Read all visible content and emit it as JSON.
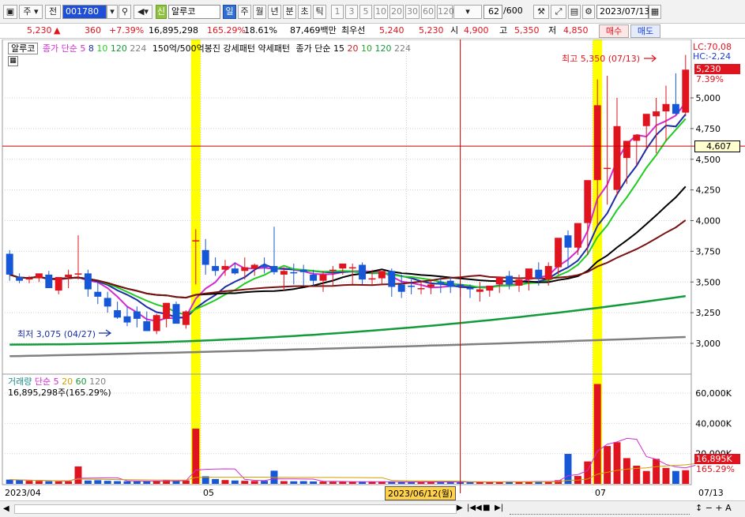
{
  "toolbar": {
    "market_label": "주",
    "prev_label": "전",
    "code": "001780",
    "stock_badge": "신",
    "stock_name": "알루코",
    "periods": [
      "일",
      "주",
      "월",
      "년",
      "분",
      "초",
      "틱"
    ],
    "active_period": "일",
    "intervals": [
      "1",
      "3",
      "5",
      "10",
      "20",
      "30",
      "60",
      "120"
    ],
    "count": "62",
    "count_total": "/600",
    "date": "2023/07/13"
  },
  "quote": {
    "price": "5,230",
    "change_arrow": "▲",
    "change": "360",
    "change_pct": "+7.39%",
    "volume": "16,895,298",
    "volume_ratio": "165.29%",
    "turnover": "18.61%",
    "amount": "87,469백만",
    "best_label": "최우선",
    "best_ask": "5,240",
    "best_bid": "5,230",
    "open_label": "시",
    "open": "4,900",
    "high_label": "고",
    "high": "5,350",
    "low_label": "저",
    "low": "4,850",
    "buy_label": "매수",
    "sell_label": "매도"
  },
  "legend": {
    "name": "알루코",
    "ma_label": "종가 단순",
    "ma_periods": [
      "5",
      "8",
      "10",
      "120",
      "224"
    ],
    "pattern": "150억/500억봉진 강세패턴  약세패턴",
    "ma2_label": "종가 단순 15",
    "ma2_periods": [
      "20",
      "10",
      "120",
      "224"
    ]
  },
  "volume_legend": {
    "label": "거래량",
    "ma_label": "단순 5",
    "ma_periods": [
      "20",
      "60",
      "120"
    ],
    "value": "16,895,298주(165.29%)"
  },
  "annotations": {
    "high_note": "최고 5,350 (07/13)",
    "low_note": "최저 3,075 (04/27)",
    "lc": "LC:70,08",
    "hc": "HC:-2,24",
    "last_price": "5,230",
    "last_pct": "7.39%",
    "cross_price": "4,607",
    "last_volume": "16,895K",
    "last_vol_pct": "165.29%",
    "cross_date": "2023/06/12(월)"
  },
  "axis": {
    "price_ticks": [
      "5,000",
      "4,750",
      "4,500",
      "4,250",
      "4,000",
      "3,750",
      "3,500",
      "3,250",
      "3,000"
    ],
    "volume_ticks": [
      "60,000K",
      "40,000K",
      "20,000K"
    ],
    "date_labels": [
      "2023/04",
      "05",
      "06",
      "07",
      "07/13"
    ]
  },
  "colors": {
    "up": "#e0141e",
    "down": "#1657d8",
    "highlight": "#ffff00",
    "ma5": "#d22bd2",
    "ma8": "#1a2ea8",
    "ma10": "#22cc22",
    "ma20": "#000000",
    "ma60": "#7a1010",
    "ma120": "#139a3a",
    "ma224": "#808080"
  },
  "chart_data": {
    "type": "candlestick",
    "dates": [
      "04/03",
      "04/04",
      "04/05",
      "04/06",
      "04/07",
      "04/10",
      "04/11",
      "04/12",
      "04/13",
      "04/14",
      "04/17",
      "04/18",
      "04/19",
      "04/20",
      "04/21",
      "04/24",
      "04/25",
      "04/26",
      "04/27",
      "04/28",
      "05/02",
      "05/03",
      "05/04",
      "05/08",
      "05/09",
      "05/10",
      "05/11",
      "05/12",
      "05/15",
      "05/16",
      "05/17",
      "05/18",
      "05/19",
      "05/22",
      "05/23",
      "05/24",
      "05/25",
      "05/26",
      "05/30",
      "05/31",
      "06/01",
      "06/02",
      "06/05",
      "06/07",
      "06/08",
      "06/09",
      "06/12",
      "06/13",
      "06/14",
      "06/15",
      "06/16",
      "06/19",
      "06/20",
      "06/21",
      "06/22",
      "06/23",
      "06/26",
      "06/27",
      "06/28",
      "06/29",
      "06/30",
      "07/03",
      "07/04",
      "07/05",
      "07/06",
      "07/07",
      "07/10",
      "07/11",
      "07/12",
      "07/13"
    ],
    "open": [
      3730,
      3540,
      3520,
      3530,
      3560,
      3430,
      3540,
      3560,
      3570,
      3420,
      3370,
      3270,
      3220,
      3260,
      3180,
      3100,
      3200,
      3320,
      3150,
      3840,
      3760,
      3630,
      3600,
      3610,
      3590,
      3610,
      3640,
      3630,
      3560,
      3580,
      3600,
      3560,
      3510,
      3590,
      3610,
      3620,
      3640,
      3520,
      3530,
      3590,
      3480,
      3470,
      3450,
      3460,
      3500,
      3510,
      3480,
      3450,
      3420,
      3430,
      3480,
      3550,
      3470,
      3520,
      3600,
      3520,
      3620,
      3880,
      3780,
      3980,
      4330,
      4430,
      4250,
      4510,
      4650,
      4770,
      4850,
      4890,
      4950,
      4880
    ],
    "high": [
      3760,
      3570,
      3550,
      3570,
      3590,
      3500,
      3600,
      3880,
      3600,
      3500,
      3420,
      3340,
      3300,
      3300,
      3260,
      3240,
      3270,
      3340,
      3270,
      3930,
      3850,
      3700,
      3680,
      3660,
      3700,
      3650,
      3700,
      3950,
      3620,
      3650,
      3640,
      3600,
      3590,
      3630,
      3650,
      3650,
      3660,
      3600,
      3580,
      3610,
      3560,
      3520,
      3500,
      3520,
      3540,
      3540,
      3510,
      3480,
      3500,
      3470,
      3520,
      3590,
      3560,
      3560,
      3660,
      3660,
      3680,
      3920,
      3950,
      4250,
      5150,
      5180,
      5000,
      4650,
      4680,
      4830,
      5000,
      5100,
      5200,
      5350
    ],
    "low": [
      3510,
      3490,
      3490,
      3500,
      3510,
      3400,
      3450,
      3520,
      3380,
      3320,
      3250,
      3200,
      3140,
      3130,
      3120,
      3075,
      3130,
      3180,
      3120,
      3480,
      3560,
      3550,
      3550,
      3560,
      3520,
      3550,
      3570,
      3560,
      3430,
      3480,
      3470,
      3470,
      3420,
      3470,
      3560,
      3480,
      3480,
      3480,
      3480,
      3380,
      3370,
      3400,
      3400,
      3400,
      3410,
      3410,
      3380,
      3370,
      3340,
      3380,
      3410,
      3440,
      3420,
      3430,
      3470,
      3470,
      3560,
      3620,
      3720,
      3720,
      3960,
      4130,
      4200,
      4300,
      4450,
      4580,
      4550,
      4650,
      4860,
      4850
    ],
    "close": [
      3560,
      3510,
      3530,
      3570,
      3450,
      3540,
      3560,
      3570,
      3440,
      3380,
      3300,
      3210,
      3170,
      3200,
      3100,
      3230,
      3330,
      3160,
      3260,
      3840,
      3640,
      3590,
      3630,
      3570,
      3620,
      3640,
      3620,
      3580,
      3590,
      3570,
      3580,
      3510,
      3560,
      3600,
      3650,
      3620,
      3520,
      3530,
      3590,
      3460,
      3420,
      3460,
      3450,
      3480,
      3480,
      3460,
      3460,
      3440,
      3440,
      3470,
      3540,
      3480,
      3520,
      3610,
      3530,
      3630,
      3860,
      3780,
      3980,
      4330,
      4940,
      4430,
      4770,
      4650,
      4700,
      4870,
      4890,
      4950,
      4870,
      5230
    ]
  },
  "volume_data": {
    "type": "bar",
    "values": [
      2.8,
      2.4,
      2.0,
      1.9,
      1.7,
      1.6,
      1.7,
      11.5,
      2.2,
      2.4,
      2.0,
      1.8,
      1.7,
      1.6,
      1.7,
      2.1,
      2.4,
      1.9,
      2.3,
      36.5,
      5.0,
      3.2,
      2.5,
      2.2,
      2.0,
      1.9,
      2.0,
      8.7,
      1.8,
      1.7,
      1.8,
      1.6,
      1.5,
      1.4,
      1.5,
      1.4,
      1.5,
      1.4,
      1.3,
      1.4,
      1.2,
      1.3,
      1.2,
      1.3,
      1.5,
      1.2,
      1.1,
      1.3,
      1.2,
      1.2,
      1.4,
      1.6,
      1.3,
      1.5,
      1.8,
      1.7,
      2.4,
      19.8,
      5.2,
      14.8,
      66.0,
      25.0,
      27.5,
      17.0,
      12.0,
      8.5,
      16.5,
      10.5,
      8.5,
      9.0,
      16.9
    ],
    "unit": "K"
  }
}
